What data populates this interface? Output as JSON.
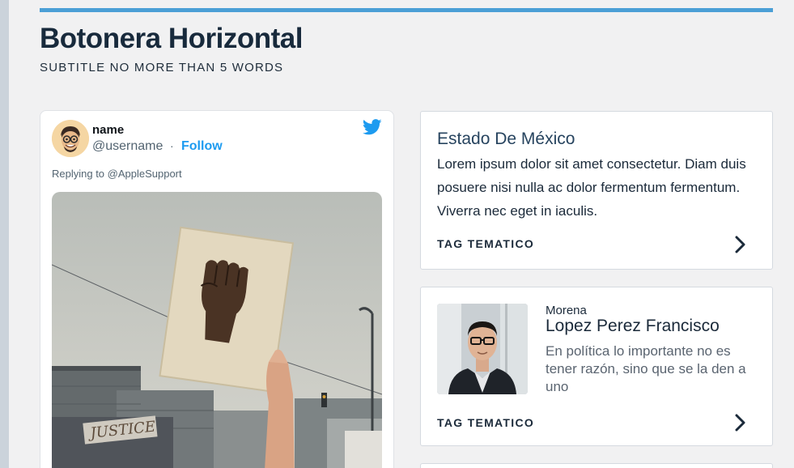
{
  "header": {
    "title": "Botonera Horizontal",
    "subtitle": "SUBTITLE NO MORE THAN 5 WORDS"
  },
  "tweet": {
    "name": "name",
    "handle": "@username",
    "separator": "·",
    "follow_label": "Follow",
    "reply_text": "Replying to @AppleSupport",
    "image_sign_text": "JUSTICE",
    "icon": "twitter-bird-icon"
  },
  "news_card": {
    "title": "Estado De México",
    "body": "Lorem ipsum dolor sit amet consectetur. Diam duis posuere nisi nulla ac dolor fermentum fermentum. Viverra nec eget in iaculis.",
    "tag": "TAG TEMATICO"
  },
  "person_card": {
    "party": "Morena",
    "name": "Lopez Perez Francisco",
    "quote": "En política lo importante no es tener razón, sino que se la den a uno",
    "tag": "TAG TEMATICO"
  },
  "colors": {
    "accent_bar": "#4b9fd6",
    "title": "#182a3c",
    "follow": "#1d9bf0",
    "card_title": "#27445f"
  }
}
